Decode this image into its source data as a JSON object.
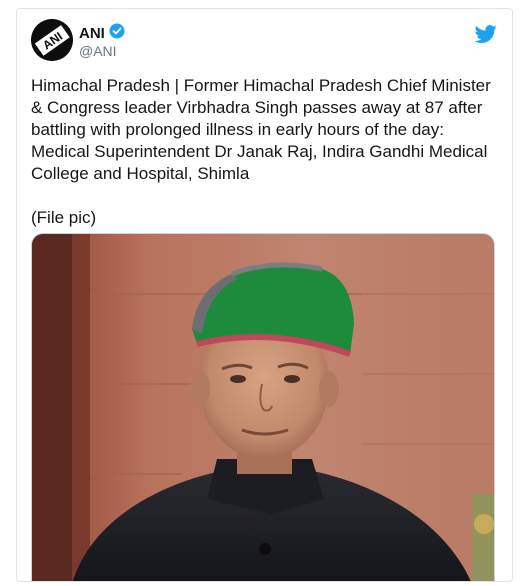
{
  "tweet": {
    "author_name": "ANI",
    "handle": "@ANI",
    "avatar_text": "ANI",
    "verified": true,
    "text": "Himachal Pradesh | Former Himachal Pradesh Chief Minister & Congress leader Virbhadra Singh passes away at 87 after battling with prolonged illness in early hours of the day: Medical Superintendent Dr Janak Raj, Indira Gandhi Medical College and Hospital, Shimla",
    "file_note": "(File pic)"
  },
  "icons": {
    "platform": "twitter-bird-icon",
    "verified": "verified-badge-icon"
  },
  "colors": {
    "brand": "#1da1f2",
    "text": "#14171a",
    "muted": "#657786"
  }
}
